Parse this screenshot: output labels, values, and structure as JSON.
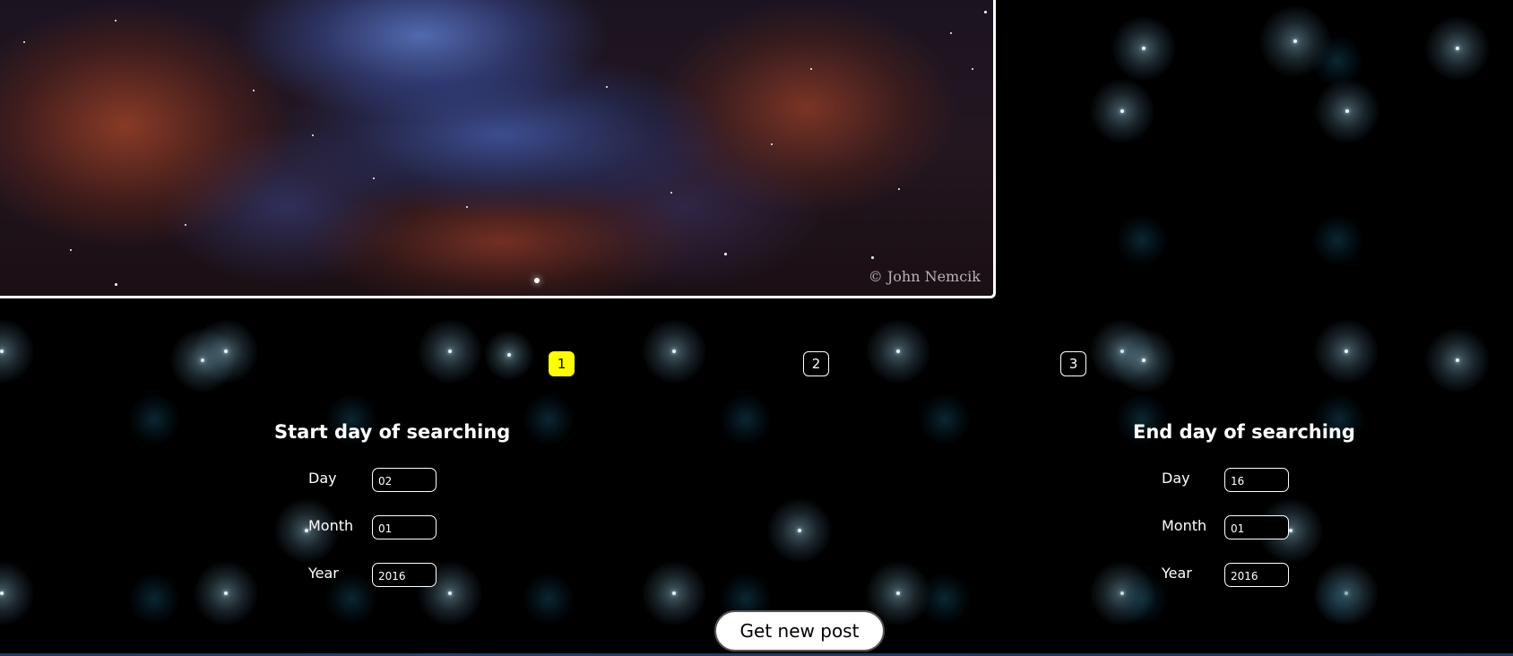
{
  "image": {
    "credit": "© John Nemcik"
  },
  "pagination": {
    "pages": [
      "1",
      "2",
      "3"
    ],
    "active": "1"
  },
  "start_panel": {
    "title": "Start day of searching",
    "day_label": "Day",
    "day_value": "02",
    "month_label": "Month",
    "month_value": "01",
    "year_label": "Year",
    "year_value": "2016"
  },
  "end_panel": {
    "title": "End day of searching",
    "day_label": "Day",
    "day_value": "16",
    "month_label": "Month",
    "month_value": "01",
    "year_label": "Year",
    "year_value": "2016"
  },
  "actions": {
    "get_new_post_label": "Get new post"
  },
  "colors": {
    "background": "#000000",
    "active_page": "#ffff00",
    "text": "#ffffff"
  }
}
